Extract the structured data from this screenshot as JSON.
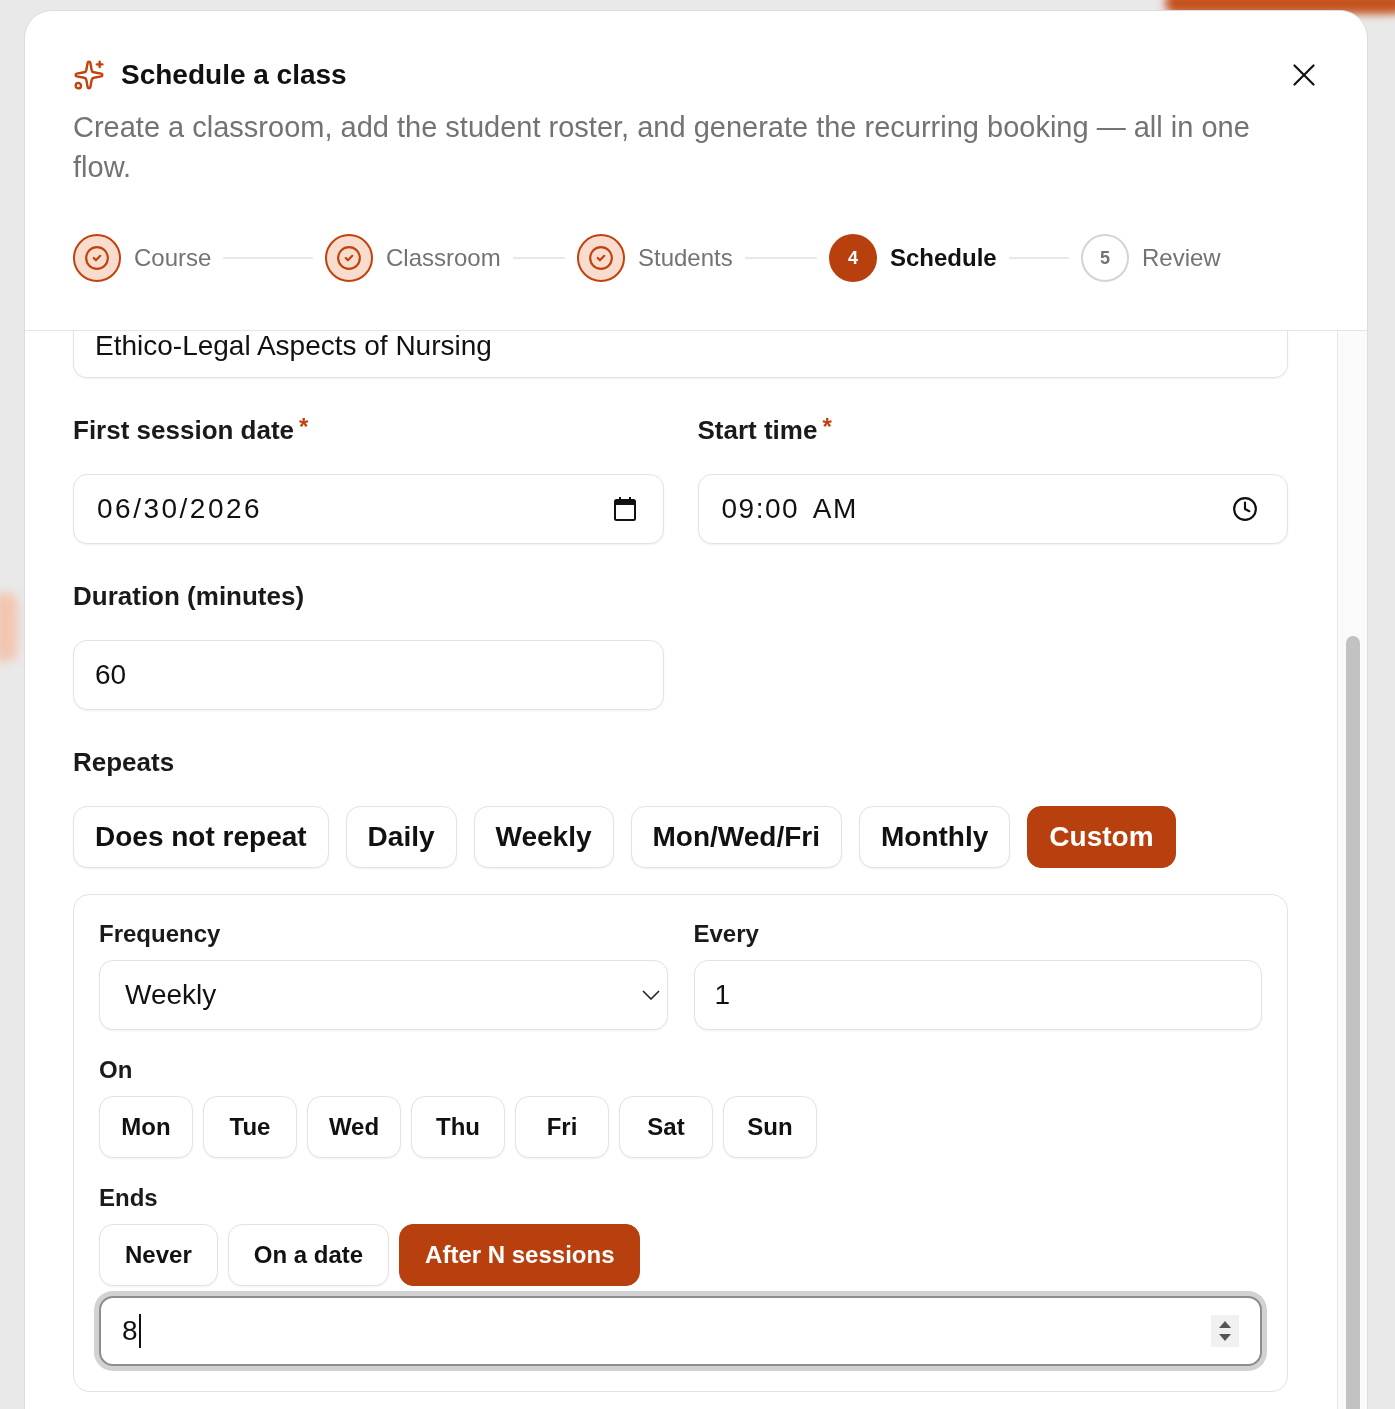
{
  "dialog": {
    "title": "Schedule a class",
    "description": "Create a classroom, add the student roster, and generate the recurring booking — all in one flow."
  },
  "steps": [
    {
      "label": "Course",
      "completed": true,
      "selected": false
    },
    {
      "label": "Classroom",
      "completed": true,
      "selected": false
    },
    {
      "label": "Students",
      "completed": true,
      "selected": false
    },
    {
      "label": "Schedule",
      "number": "4",
      "completed": false,
      "selected": true
    },
    {
      "label": "Review",
      "number": "5",
      "completed": false,
      "selected": false
    }
  ],
  "course_field": {
    "value": "Ethico-Legal Aspects of Nursing"
  },
  "first_session_date": {
    "label": "First session date",
    "required_mark": "*",
    "value": "06/30/2026"
  },
  "start_time": {
    "label": "Start time",
    "required_mark": "*",
    "value": "09:00 AM"
  },
  "duration": {
    "label": "Duration (minutes)",
    "value": "60"
  },
  "repeats": {
    "label": "Repeats",
    "options": [
      {
        "label": "Does not repeat",
        "selected": false
      },
      {
        "label": "Daily",
        "selected": false
      },
      {
        "label": "Weekly",
        "selected": false
      },
      {
        "label": "Mon/Wed/Fri",
        "selected": false
      },
      {
        "label": "Monthly",
        "selected": false
      },
      {
        "label": "Custom",
        "selected": true
      }
    ]
  },
  "custom_rule": {
    "frequency": {
      "label": "Frequency",
      "value": "Weekly"
    },
    "every": {
      "label": "Every",
      "value": "1"
    },
    "on": {
      "label": "On",
      "days": [
        {
          "label": "Mon",
          "selected": false
        },
        {
          "label": "Tue",
          "selected": false
        },
        {
          "label": "Wed",
          "selected": false
        },
        {
          "label": "Thu",
          "selected": false
        },
        {
          "label": "Fri",
          "selected": false
        },
        {
          "label": "Sat",
          "selected": false
        },
        {
          "label": "Sun",
          "selected": false
        }
      ]
    },
    "ends": {
      "label": "Ends",
      "options": [
        {
          "label": "Never",
          "selected": false
        },
        {
          "label": "On a date",
          "selected": false
        },
        {
          "label": "After N sessions",
          "selected": true
        }
      ],
      "sessions": {
        "value": "8",
        "focused": true
      }
    }
  }
}
